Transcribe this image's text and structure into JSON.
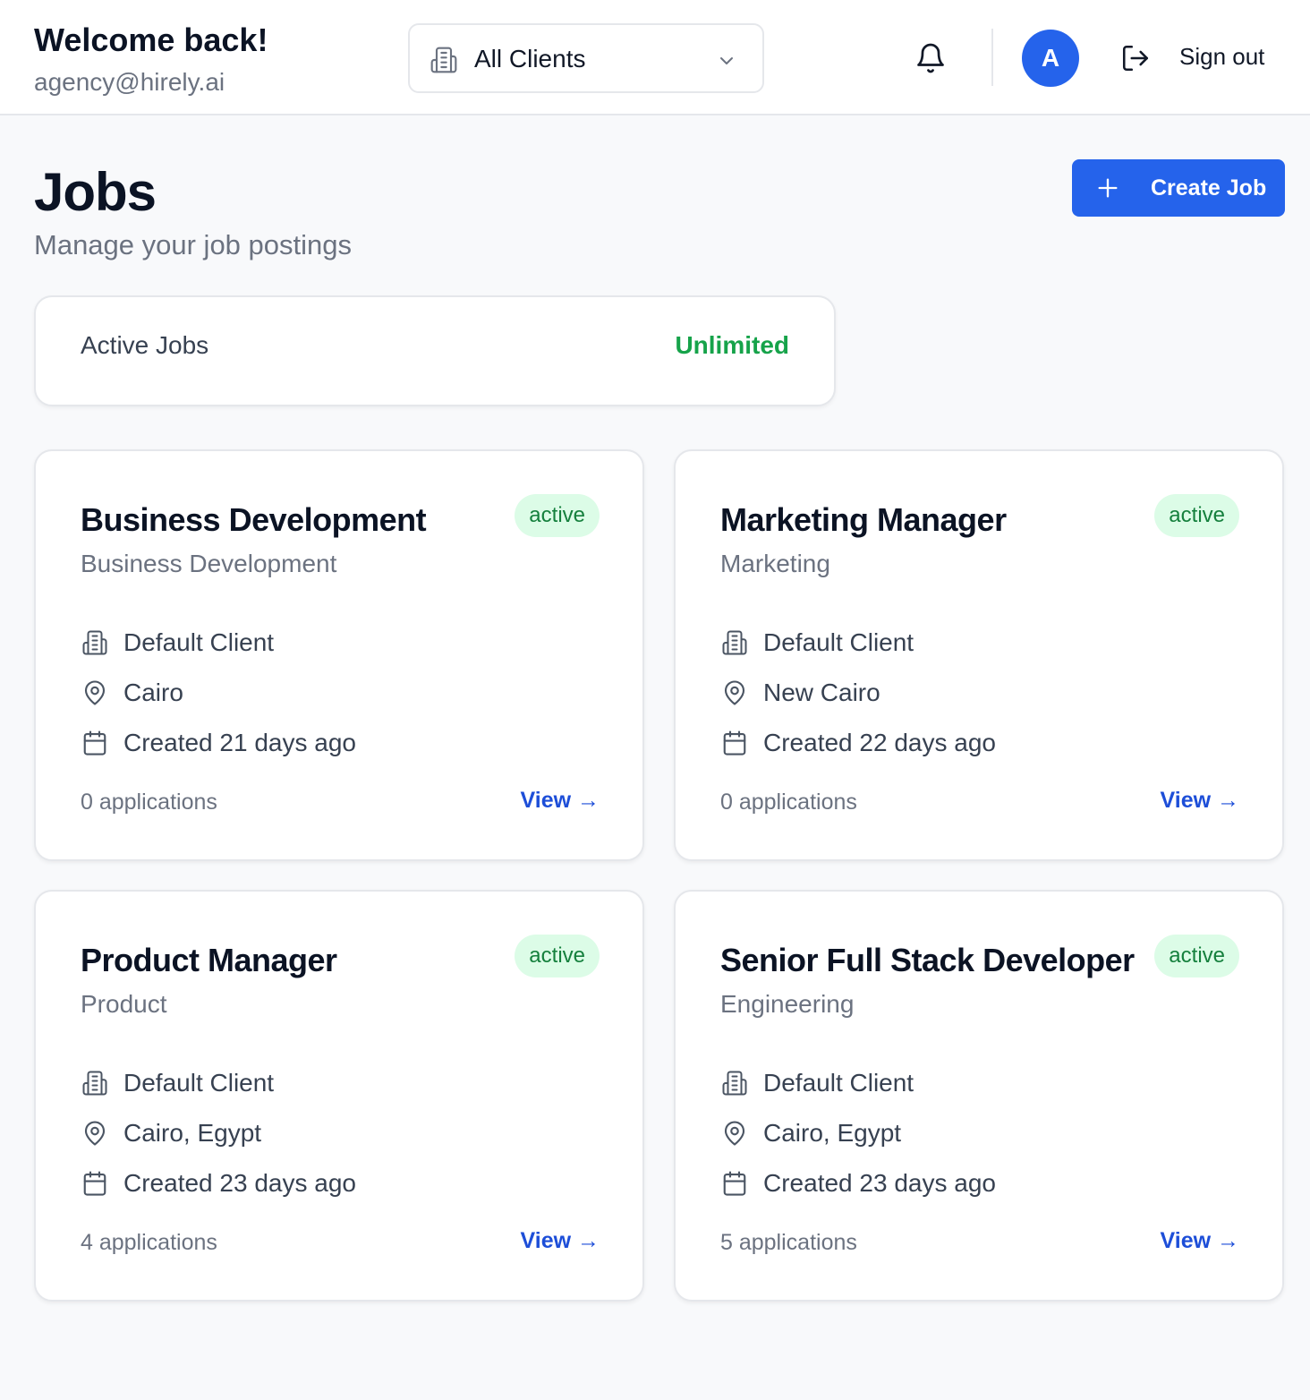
{
  "header": {
    "welcome": "Welcome back!",
    "email": "agency@hirely.ai",
    "client_filter": "All Clients",
    "avatar_initial": "A",
    "sign_out": "Sign out"
  },
  "page": {
    "title": "Jobs",
    "subtitle": "Manage your job postings",
    "create_label": "Create Job"
  },
  "active_jobs": {
    "label": "Active Jobs",
    "value": "Unlimited"
  },
  "colors": {
    "primary": "#2563eb",
    "success": "#16a34a",
    "badge_bg": "#dcfce7",
    "link": "#1d4ed8"
  },
  "jobs": [
    {
      "title": "Business Development",
      "department": "Business Development",
      "status": "active",
      "client": "Default Client",
      "location": "Cairo",
      "created": "Created 21 days ago",
      "applications": "0 applications",
      "view_label": "View →"
    },
    {
      "title": "Marketing Manager",
      "department": "Marketing",
      "status": "active",
      "client": "Default Client",
      "location": "New Cairo",
      "created": "Created 22 days ago",
      "applications": "0 applications",
      "view_label": "View →"
    },
    {
      "title": "Product Manager",
      "department": "Product",
      "status": "active",
      "client": "Default Client",
      "location": "Cairo, Egypt",
      "created": "Created 23 days ago",
      "applications": "4 applications",
      "view_label": "View →"
    },
    {
      "title": "Senior Full Stack Developer",
      "department": "Engineering",
      "status": "active",
      "client": "Default Client",
      "location": "Cairo, Egypt",
      "created": "Created 23 days ago",
      "applications": "5 applications",
      "view_label": "View →"
    }
  ]
}
